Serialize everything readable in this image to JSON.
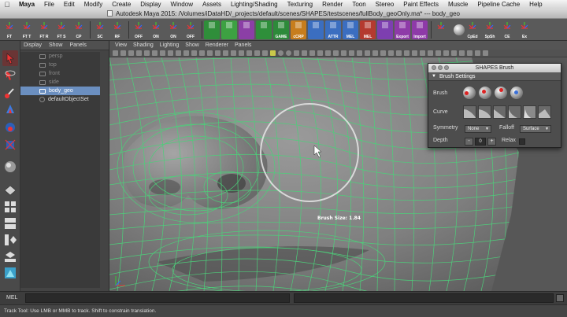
{
  "menubar": {
    "app_name": "Maya",
    "items": [
      "File",
      "Edit",
      "Modify",
      "Create",
      "Display",
      "Window",
      "Assets",
      "Lighting/Shading",
      "Texturing",
      "Render",
      "Toon",
      "Stereo",
      "Paint Effects",
      "Muscle",
      "Pipeline Cache",
      "Help"
    ]
  },
  "window": {
    "title": "Autodesk Maya 2015: /Volumes/iDataHD/_projects/default/scenes/SHAPES/testscenes/fullBody_geoOnly.ma*   ---   body_geo"
  },
  "shelf": {
    "tools": [
      {
        "label": "FT",
        "color": "#5a5a5a"
      },
      {
        "label": "FT T",
        "color": "#5a5a5a"
      },
      {
        "label": "FT R",
        "color": "#5a5a5a"
      },
      {
        "label": "FT S",
        "color": "#5a5a5a"
      },
      {
        "label": "CP",
        "color": "#5a5a5a"
      },
      {
        "label": "SC",
        "color": "#5a5a5a"
      },
      {
        "label": "RF",
        "color": "#5a5a5a"
      },
      {
        "label": "OFF",
        "color": "#5a5a5a"
      },
      {
        "label": "ON",
        "color": "#5a5a5a"
      },
      {
        "label": "ON",
        "color": "#5a5a5a"
      },
      {
        "label": "OFF",
        "color": "#5a5a5a"
      },
      {
        "label": "",
        "color": "#2f8e3a"
      },
      {
        "label": "",
        "color": "#3da142"
      },
      {
        "label": "",
        "color": "#8b3fa6"
      },
      {
        "label": "",
        "color": "#2e8f3a"
      },
      {
        "label": "GAME",
        "color": "#2d8a3a"
      },
      {
        "label": "cCRP",
        "color": "#c77d1d"
      },
      {
        "label": "",
        "color": "#3b6ec0"
      },
      {
        "label": "ATTR",
        "color": "#3b6ec0"
      },
      {
        "label": "MEL",
        "color": "#3b6ec0"
      },
      {
        "label": "MEL",
        "color": "#b43a2f"
      },
      {
        "label": "",
        "color": "#7d3fb0"
      },
      {
        "label": "Export",
        "color": "#8e3aa8"
      },
      {
        "label": "Import",
        "color": "#8e3aa8"
      },
      {
        "label": "",
        "color": "#5a5a5a"
      },
      {
        "label": "CpEd",
        "color": "#5a5a5a"
      },
      {
        "label": "SpSh",
        "color": "#5a5a5a"
      },
      {
        "label": "CE",
        "color": "#5a5a5a"
      },
      {
        "label": "Ex",
        "color": "#5a5a5a"
      }
    ]
  },
  "outliner": {
    "menu": [
      "Display",
      "Show",
      "Panels"
    ],
    "items": [
      {
        "label": "persp",
        "state": "dim"
      },
      {
        "label": "top",
        "state": "dim"
      },
      {
        "label": "front",
        "state": "dim"
      },
      {
        "label": "side",
        "state": "dim"
      },
      {
        "label": "body_geo",
        "state": "selected"
      },
      {
        "label": "defaultObjectSet",
        "state": "set"
      }
    ]
  },
  "viewport": {
    "menu": [
      "View",
      "Shading",
      "Lighting",
      "Show",
      "Renderer",
      "Panels"
    ],
    "brush_size_label": "Brush Size: 1.84",
    "wire_color": "#4dcf7a"
  },
  "shapes_brush": {
    "title": "SHAPES Brush",
    "section": "Brush Settings",
    "brush_label": "Brush",
    "curve_label": "Curve",
    "symmetry_label": "Symmetry",
    "symmetry_value": "None",
    "falloff_label": "Falloff",
    "falloff_value": "Surface",
    "depth_label": "Depth",
    "depth_minus": "-",
    "depth_value": "0",
    "depth_plus": "+",
    "relax_label": "Relax"
  },
  "cmdline": {
    "mel_label": "MEL"
  },
  "helpline": {
    "text": "Track Tool: Use LMB or MMB to track. Shift to constrain translation."
  }
}
